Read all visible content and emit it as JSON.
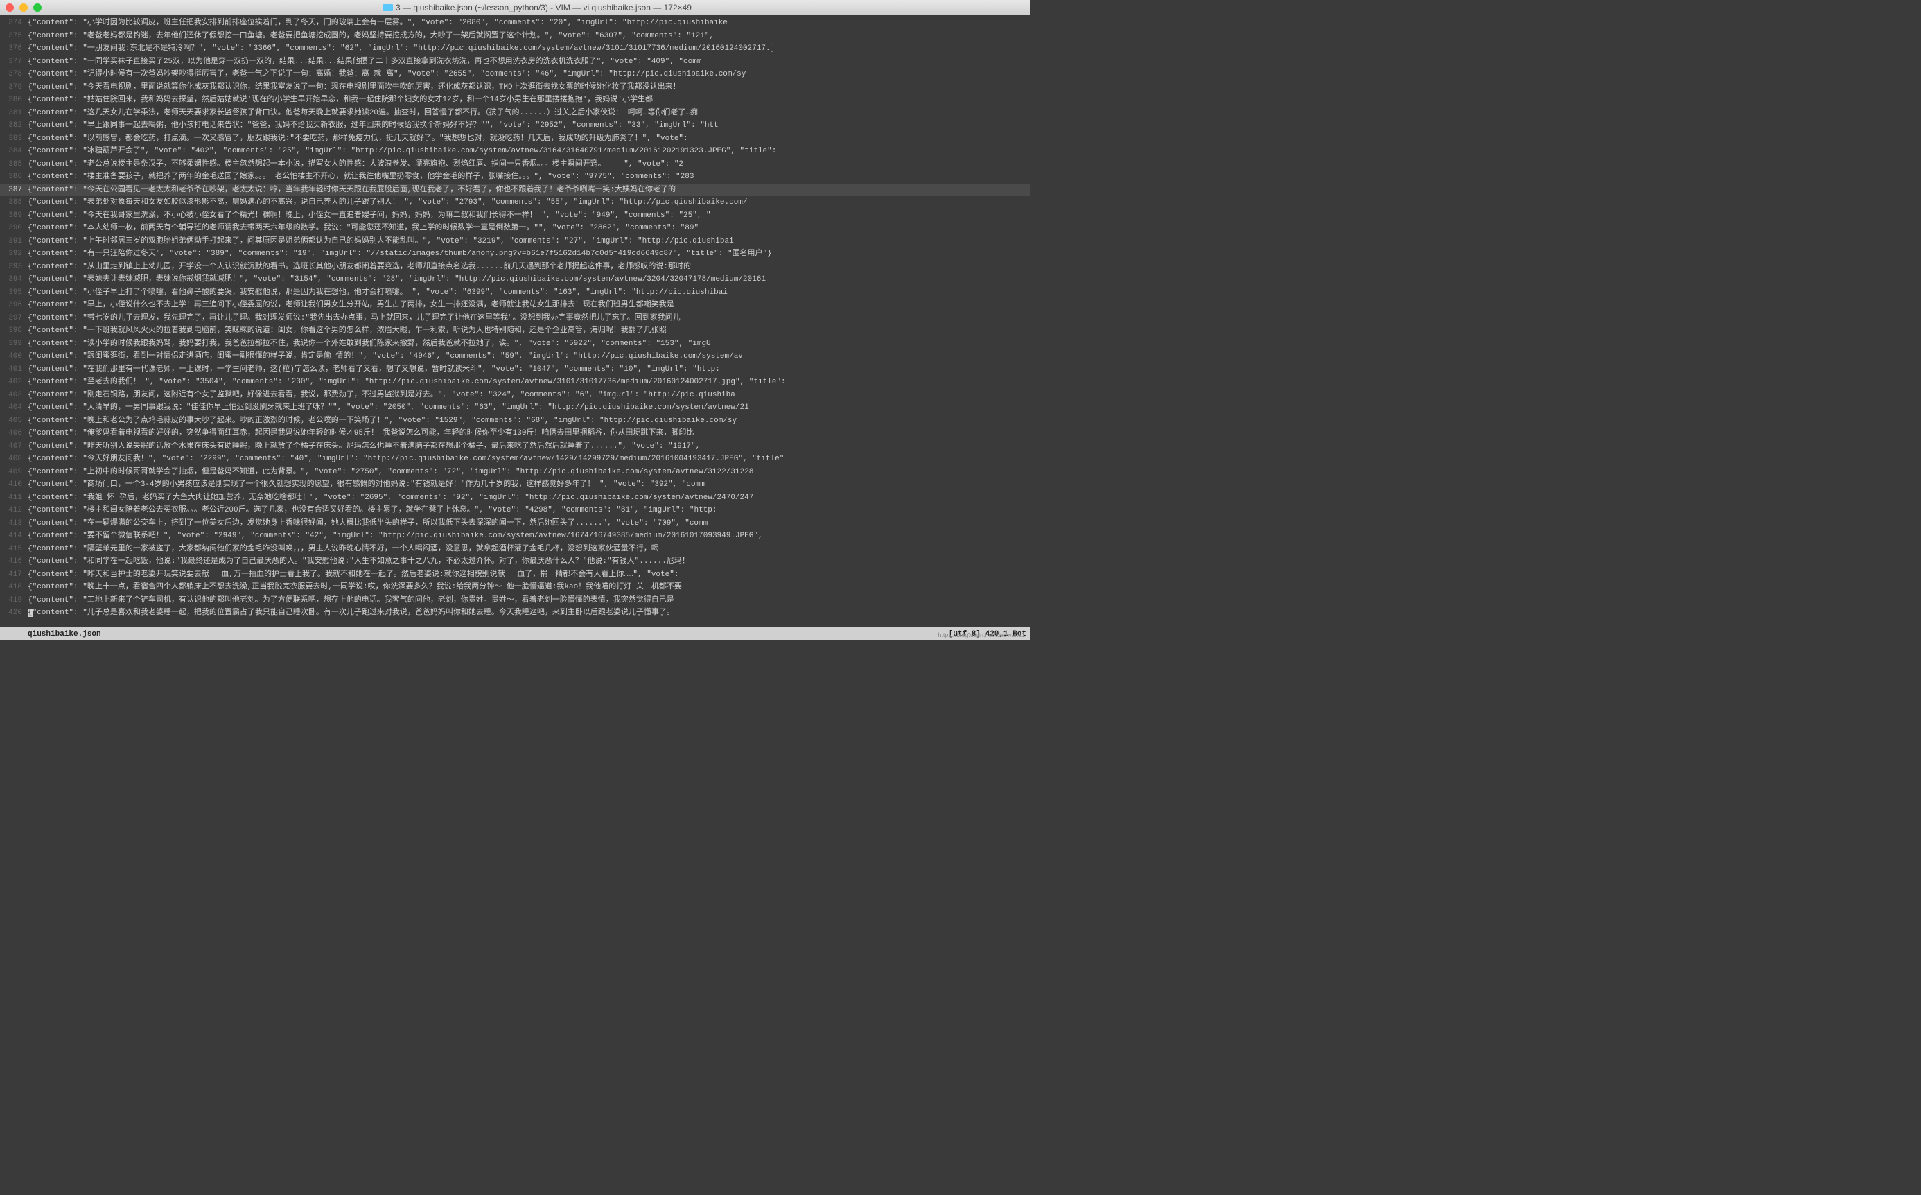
{
  "title": {
    "folder": "3",
    "file": "qiushibaike.json",
    "path": "(~/lesson_python/3)",
    "app": "VIM",
    "cmd": "vi qiushibaike.json",
    "dim": "172×49"
  },
  "statusbar": {
    "file": "qiushibaike.json",
    "encoding": "[utf-8]",
    "pos": "420,1",
    "loc": "Bot"
  },
  "watermark": "https://blog.csdn.net/xiaoweite1",
  "lines": [
    {
      "n": 374,
      "t": "{\"content\": \"小学时因为比较调皮，班主任把我安排到前排座位挨着门，到了冬天，门的玻璃上会有一层雾。\", \"vote\": \"2080\", \"comments\": \"20\", \"imgUrl\": \"http://pic.qiushibaike"
    },
    {
      "n": 375,
      "t": "{\"content\": \"老爸老妈都是钓迷，去年他们还休了假想挖一口鱼塘。老爸要把鱼塘挖成圆的，老妈坚持要挖成方的，大吵了一架后就搁置了这个计划。\", \"vote\": \"6307\", \"comments\": \"121\","
    },
    {
      "n": 376,
      "t": "{\"content\": \"一朋友问我:东北是不是特冷啊？\", \"vote\": \"3366\", \"comments\": \"62\", \"imgUrl\": \"http://pic.qiushibaike.com/system/avtnew/3101/31017736/medium/20160124002717.j"
    },
    {
      "n": 377,
      "t": "{\"content\": \"一同学买袜子直接买了25双，以为他是穿一双扔一双的，结果...结果...结果他攒了二十多双直接拿到洗衣坊洗，再也不想用洗衣房的洗衣机洗衣服了\", \"vote\": \"409\", \"comm"
    },
    {
      "n": 378,
      "t": "{\"content\": \"记得小时候有一次爸妈吵架吵得挺厉害了，老爸一气之下说了一句：离婚！我爸：离 就 离\", \"vote\": \"2655\", \"comments\": \"46\", \"imgUrl\": \"http://pic.qiushibaike.com/sy"
    },
    {
      "n": 379,
      "t": "{\"content\": \"今天看电视剧，里面说就算你化成灰我都认识你，结果我室友说了一句：现在电视剧里面吹牛吹的厉害，还化成灰都认识，TMD上次逛街去找女票的时候她化妆了我都没认出来！"
    },
    {
      "n": 380,
      "t": "{\"content\": \"姑姑住院回来，我和妈妈去探望，然后姑姑就说'现在的小学生早开始早恋，和我一起住院那个妇女的女才12岁，和一个14岁小男生在那里搂搂抱抱'，我妈说'小学生都"
    },
    {
      "n": 381,
      "t": "{\"content\": \"这几天女儿在学乘法，老师天天要求家长监督孩子背口诀。他爸每天晚上就要求她读20遍。抽查时，回答慢了都不行。（孩子气的......）过关之后小家伙说： 呵呵…等你们老了…痴"
    },
    {
      "n": 382,
      "t": "{\"content\": \"早上跟同事一起去喝粥，他小孩打电话来告状：\"爸爸，我妈不给我买新衣服，过年回来的时候给我换个新妈好不好？\"\", \"vote\": \"2952\", \"comments\": \"33\", \"imgUrl\": \"htt"
    },
    {
      "n": 383,
      "t": "{\"content\": \"以前感冒，都会吃药，打点滴。一次又感冒了，朋友跟我说:\"不要吃药，那样免疫力低，挺几天就好了。\"我想想也对，就没吃药！几天后，我成功的升级为肺炎了！\", \"vote\":"
    },
    {
      "n": 384,
      "t": "{\"content\": \"冰糖葫芦开会了\", \"vote\": \"402\", \"comments\": \"25\", \"imgUrl\": \"http://pic.qiushibaike.com/system/avtnew/3164/31640791/medium/20161202191323.JPEG\", \"title\": "
    },
    {
      "n": 385,
      "t": "{\"content\": \"老公总说楼主是条汉子，不够柔媚性感。楼主忽然想起一本小说，描写女人的性感：大波浪卷发、漂亮旗袍、烈焰红唇、指间一只香烟。。。楼主瞬间开窍。    \", \"vote\": \"2"
    },
    {
      "n": 386,
      "t": "{\"content\": \"楼主准备要孩子，就把养了两年的金毛送回了娘家。。。 老公怕楼主不开心，就让我往他嘴里扔零食，他学金毛的样子，张嘴接住。。。\", \"vote\": \"9775\", \"comments\": \"283"
    },
    {
      "n": 387,
      "t": "{\"content\": \"今天在公园看见一老太太和老爷爷在吵架，老太太说：哼，当年我年轻时你天天跟在我屁股后面,现在我老了，不好看了，你也不跟着我了！老爷爷咧嘴一笑:大姨妈在你老了的",
      "act": true
    },
    {
      "n": 388,
      "t": "{\"content\": \"表弟处对象每天和女友如胶似漆形影不离，舅妈满心的不高兴，说自己养大的儿子跟了别人！ \", \"vote\": \"2793\", \"comments\": \"55\", \"imgUrl\": \"http://pic.qiushibaike.com/"
    },
    {
      "n": 389,
      "t": "{\"content\": \"今天在我哥家里洗澡，不小心被小侄女看了个精光！稞啊！晚上，小侄女一直追着嫂子问，妈妈，妈妈，为嘛二叔和我们长得不一样！ \", \"vote\": \"949\", \"comments\": \"25\", \""
    },
    {
      "n": 390,
      "t": "{\"content\": \"本人幼师一枚，前两天有个辅导班的老师请我去带两天六年级的数学。我说：\"可能您还不知道，我上学的时候数学一直是倒数第一。\"\", \"vote\": \"2862\", \"comments\": \"89\""
    },
    {
      "n": 391,
      "t": "{\"content\": \"上午时邻居三岁的双胞胎姐弟俩动手打起来了，问其原因是姐弟俩都认为自己的妈妈别人不能乱叫。\", \"vote\": \"3219\", \"comments\": \"27\", \"imgUrl\": \"http://pic.qiushibai"
    },
    {
      "n": 392,
      "t": "{\"content\": \"有一只汪陪你过冬天\", \"vote\": \"389\", \"comments\": \"19\", \"imgUrl\": \"//static/images/thumb/anony.png?v=b61e7f5162d14b7c0d5f419cd6649c87\", \"title\": \"匿名用户\"}"
    },
    {
      "n": 393,
      "t": "{\"content\": \"从山里走到镇上上幼儿园，开学没一个人认识就沉默的看书。选班长其他小朋友都闹着要竞选，老师却直接点名选我......前几天遇到那个老师提起这件事，老师感叹的说:那时的"
    },
    {
      "n": 394,
      "t": "{\"content\": \"表妹夫让表妹减肥，表妹说你戒烟我就减肥！\", \"vote\": \"3154\", \"comments\": \"28\", \"imgUrl\": \"http://pic.qiushibaike.com/system/avtnew/3204/32047178/medium/20161"
    },
    {
      "n": 395,
      "t": "{\"content\": \"小侄子早上打了个喷嚏，看他鼻子酸的要哭，我安慰他说，那是因为我在想他，他才会打喷嚏。 \", \"vote\": \"6399\", \"comments\": \"163\", \"imgUrl\": \"http://pic.qiushibai"
    },
    {
      "n": 396,
      "t": "{\"content\": \"早上，小侄说什么也不去上学！再三追问下小侄委屈的说，老师让我们男女生分开站，男生占了两排，女生一排还没满，老师就让我站女生那排去！现在我们班男生都嘲笑我是"
    },
    {
      "n": 397,
      "t": "{\"content\": \"带七岁的儿子去理发，我先理完了，再让儿子理。我对理发师说:\"我先出去办点事，马上就回来，儿子理完了让他在这里等我\"。没想到我办完事竟然把儿子忘了。回到家我问儿"
    },
    {
      "n": 398,
      "t": "{\"content\": \"一下班我就风风火火的拉着我到电脑前，笑眯眯的说道：闺女，你看这个男的怎么样，浓眉大眼，乍一利索，听说为人也特别随和，还是个企业高管，海归呢！我翻了几张照"
    },
    {
      "n": 399,
      "t": "{\"content\": \"读小学的时候我跟我妈骂，我妈要打我，我爸爸拉都拉不住，我说你一个外姓敢到我们陈家来撒野，然后我爸就不拉她了，诶。\", \"vote\": \"5922\", \"comments\": \"153\", \"imgU"
    },
    {
      "n": 400,
      "t": "{\"content\": \"跟闺蜜逛街，看到一对情侣走进酒店，闺蜜一副很懂的样子说，肯定是偷 情的！\", \"vote\": \"4946\", \"comments\": \"59\", \"imgUrl\": \"http://pic.qiushibaike.com/system/av"
    },
    {
      "n": 401,
      "t": "{\"content\": \"在我们那里有一代课老师，一上课时，一学生问老师，这(粒)字怎么读，老师看了又看，想了又想说，暂时就读米斗\", \"vote\": \"1047\", \"comments\": \"10\", \"imgUrl\": \"http:"
    },
    {
      "n": 402,
      "t": "{\"content\": \"至老去的我们！ \", \"vote\": \"3504\", \"comments\": \"230\", \"imgUrl\": \"http://pic.qiushibaike.com/system/avtnew/3101/31017736/medium/20160124002717.jpg\", \"title\": "
    },
    {
      "n": 403,
      "t": "{\"content\": \"刚走石铜路，朋友问，这附近有个女子监狱吧，好像进去看看，我说，那费劲了，不过男监狱到是好去。\", \"vote\": \"324\", \"comments\": \"6\", \"imgUrl\": \"http://pic.qiushiba"
    },
    {
      "n": 404,
      "t": "{\"content\": \"大清早的，一男同事跟我说：\"佳佳你早上怕迟到没刷牙就来上班了咪？\"\", \"vote\": \"2050\", \"comments\": \"63\", \"imgUrl\": \"http://pic.qiushibaike.com/system/avtnew/21"
    },
    {
      "n": 405,
      "t": "{\"content\": \"晚上和老公为了点鸡毛蒜皮的事大吵了起来。吵的正激烈的时候，老公噗的一下笑场了！\", \"vote\": \"1529\", \"comments\": \"68\", \"imgUrl\": \"http://pic.qiushibaike.com/sy"
    },
    {
      "n": 406,
      "t": "{\"content\": \"俺爹妈看着电视看的好好的，突然争得面红耳赤，起因是我妈说她年轻的时候才95斤！ 我爸说怎么可能，年轻的时候你至少有130斤！咱俩去田里捆稻谷，你从田埂跳下来，脚印比"
    },
    {
      "n": 407,
      "t": "{\"content\": \"昨天听别人说失眠的话放个水果在床头有助睡眠，晚上就放了个橘子在床头。尼玛怎么也睡不着满脑子都在想那个橘子，最后来吃了然后然后就睡着了......\", \"vote\": \"1917\","
    },
    {
      "n": 408,
      "t": "{\"content\": \"今天好朋友问我！\", \"vote\": \"2299\", \"comments\": \"40\", \"imgUrl\": \"http://pic.qiushibaike.com/system/avtnew/1429/14299729/medium/20161004193417.JPEG\", \"title\""
    },
    {
      "n": 409,
      "t": "{\"content\": \"上初中的时候哥哥就学会了抽烟，但是爸妈不知道，此为背景。\", \"vote\": \"2750\", \"comments\": \"72\", \"imgUrl\": \"http://pic.qiushibaike.com/system/avtnew/3122/31228"
    },
    {
      "n": 410,
      "t": "{\"content\": \"商场门口，一个3-4岁的小男孩应该是刚实现了一个很久就想实现的愿望，很有感慨的对他妈说:\"有钱就是好！\"作为几十岁的我，这样感觉好多年了！ \", \"vote\": \"392\", \"comm"
    },
    {
      "n": 411,
      "t": "{\"content\": \"我姐 怀 孕后，老妈买了大鱼大肉让她加营养，无奈她吃啥都吐！\", \"vote\": \"2695\", \"comments\": \"92\", \"imgUrl\": \"http://pic.qiushibaike.com/system/avtnew/2470/247"
    },
    {
      "n": 412,
      "t": "{\"content\": \"楼主和闺女陪着老公去买衣服。。。老公近200斤。选了几家，也没有合适又好看的。楼主累了，就坐在凳子上休息。\", \"vote\": \"4298\", \"comments\": \"81\", \"imgUrl\": \"http:"
    },
    {
      "n": 413,
      "t": "{\"content\": \"在一辆爆满的公交车上，挤到了一位美女后边，发觉她身上香味很好闻，她大概比我低半头的样子，所以我低下头去深深的闻一下，然后她回头了......\", \"vote\": \"709\", \"comm"
    },
    {
      "n": 414,
      "t": "{\"content\": \"要不留个微信联系吧！\", \"vote\": \"2949\", \"comments\": \"42\", \"imgUrl\": \"http://pic.qiushibaike.com/system/avtnew/1674/16749385/medium/20161017093949.JPEG\","
    },
    {
      "n": 415,
      "t": "{\"content\": \"隔壁单元里的一家被盗了，大家都纳闷他们家的金毛咋没叫唤，，，男主人说昨晚心情不好，一个人喝闷酒，没意思，就拿起酒杯灌了金毛几杯，没想到这家伙酒量不行，喝"
    },
    {
      "n": 416,
      "t": "{\"content\": \"和同学在一起吃饭，他说:\"我最终还是成为了自己最厌恶的人。\"我安慰他说:\"人生不如意之事十之八九，不必太过介怀。对了，你最厌恶什么人？\"他说:\"有钱人\"......尼玛！"
    },
    {
      "n": 417,
      "t": "{\"content\": \"昨天和当护士的老婆开玩笑说要去献　 血,万一抽血的护士看上我了。我就不和她在一起了。然后老婆说:就你这相貌别说献　 血了，捐　精都不会有人看上你……\", \"vote\":"
    },
    {
      "n": 418,
      "t": "{\"content\": \"晚上十一点，看宿舍四个人都躺床上不想去洗澡,正当我脱完衣服要去时,一同学说:哎，你洗澡要多久？我说:给我两分钟～ 他一脸懵逼道:我kao！我他喵的打灯 关　机都不要"
    },
    {
      "n": 419,
      "t": "{\"content\": \"工地上新来了个铲车司机，有认识他的都叫他老刘。为了方便联系吧，想存上他的电话。我客气的问他，老刘，你贵姓。贵姓～，看着老刘一脸懵懂的表情，我突然觉得自己是"
    },
    {
      "n": 420,
      "t": "{\"content\": \"儿子总是喜欢和我老婆睡一起，把我的位置霸占了我只能自己睡次卧。有一次儿子跑过来对我说，爸爸妈妈叫你和她去睡。今天我睡这吧，来到主卧以后跟老婆说儿子懂事了。"
    }
  ]
}
